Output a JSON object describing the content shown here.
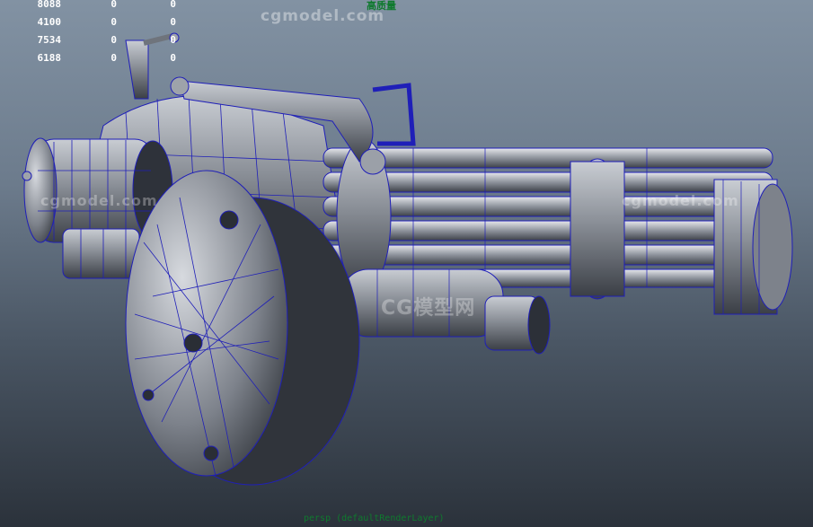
{
  "viewport": {
    "camera_label": "persp (defaultRenderLayer)",
    "top_label": "高质量",
    "background_top": "#8292a3",
    "background_bottom": "#2b323b",
    "wire_color": "#1f1fb8"
  },
  "heads_up": {
    "rows": [
      [
        "8088",
        "0",
        "0"
      ],
      [
        "4100",
        "0",
        "0"
      ],
      [
        "7534",
        "0",
        "0"
      ],
      [
        "6188",
        "0",
        "0"
      ]
    ]
  },
  "watermarks": {
    "top": "cgmodel.com",
    "left": "cgmodel.com",
    "right": "cgmodel.com",
    "center": "CG模型网"
  },
  "model": {
    "name": "minigun",
    "parts": [
      "barrel-assembly",
      "barrel-ring-front",
      "barrel-ring-mid",
      "ammo-drum",
      "rear-housing",
      "carry-handle",
      "crank-handle",
      "side-tube"
    ]
  }
}
